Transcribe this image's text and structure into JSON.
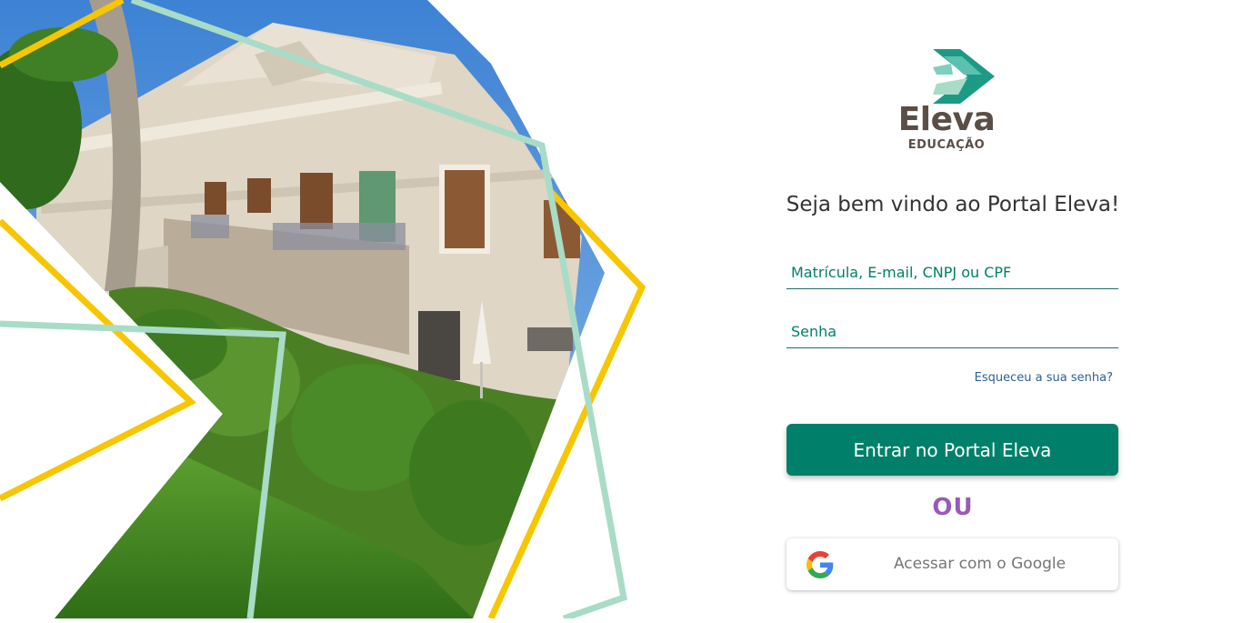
{
  "brand": {
    "name": "Eleva",
    "subtitle": "EDUCAÇÃO"
  },
  "welcome": "Seja bem vindo ao Portal Eleva!",
  "login": {
    "user_placeholder": "Matrícula, E-mail, CNPJ ou CPF",
    "password_placeholder": "Senha",
    "forgot_label": "Esqueceu a sua senha?",
    "submit_label": "Entrar no Portal Eleva",
    "separator": "OU",
    "google_label": "Acessar com o Google"
  },
  "colors": {
    "primary": "#00806a",
    "accent_yellow": "#f7c600",
    "accent_mint": "#a8dcc6",
    "separator_purple": "#9b59b6",
    "brand_text": "#5a4e47"
  },
  "icons": {
    "logo": "eleva-chevron-logo",
    "google": "google-g-icon"
  }
}
